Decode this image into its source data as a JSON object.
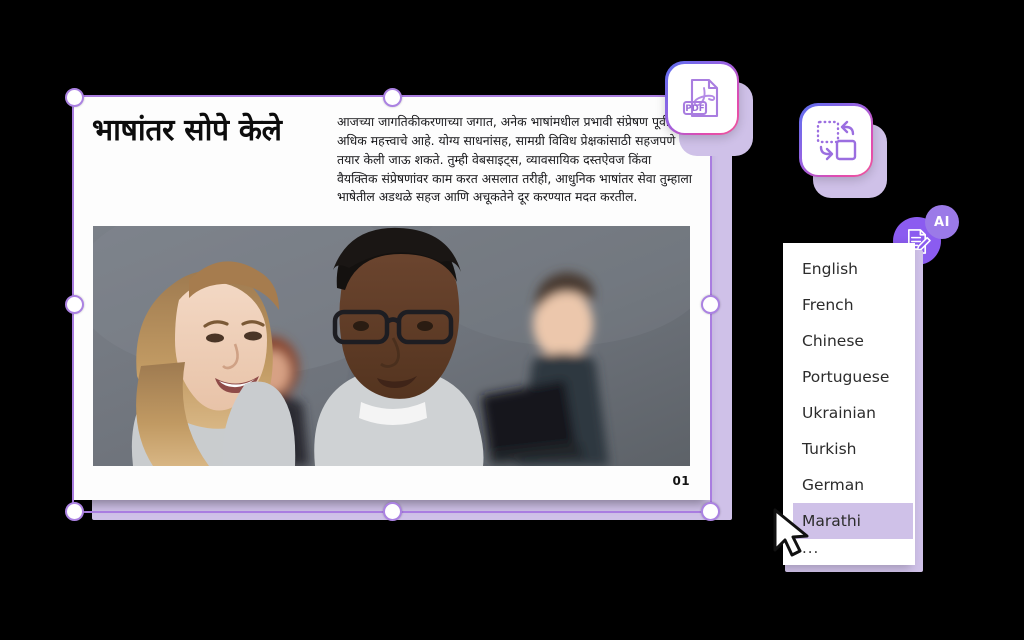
{
  "slide": {
    "title": "भाषांतर सोपे केले",
    "body": "आजच्या जागतिकीकरणाच्या जगात, अनेक भाषांमधील प्रभावी संप्रेषण पूर्वीपेक्षा अधिक महत्त्वाचे आहे. योग्य साधनांसह, सामग्री विविध प्रेक्षकांसाठी सहजपणे तयार केली जाऊ शकते. तुम्ही वेबसाइट्स, व्यावसायिक दस्तऐवज किंवा वैयक्तिक संप्रेषणांवर काम करत असलात तरीही, आधुनिक भाषांतर सेवा तुम्हाला भाषेतील अडथळे सहज आणि अचूकतेने दूर करण्यात मदत करतील.",
    "page_number": "01",
    "photo_alt": "office-people-photo"
  },
  "tiles": [
    {
      "name": "pdf-file-icon",
      "label": "PDF"
    },
    {
      "name": "convert-format-icon",
      "label": ""
    }
  ],
  "ai_badge": {
    "label": "AI",
    "icon": "document-edit-icon"
  },
  "language_dropdown": {
    "items": [
      {
        "label": "English",
        "selected": false
      },
      {
        "label": "French",
        "selected": false
      },
      {
        "label": "Chinese",
        "selected": false
      },
      {
        "label": "Portuguese",
        "selected": false
      },
      {
        "label": "Ukrainian",
        "selected": false
      },
      {
        "label": "Turkish",
        "selected": false
      },
      {
        "label": "German",
        "selected": false
      },
      {
        "label": "Marathi",
        "selected": true
      }
    ],
    "more_label": "..."
  },
  "colors": {
    "accent_purple": "#8b5cf0",
    "soft_purple": "#cfc1e8",
    "selection_border": "#a97de0",
    "highlight": "#cfc1e8",
    "gradient_start": "#5b6ef0",
    "gradient_end": "#f0569a"
  }
}
